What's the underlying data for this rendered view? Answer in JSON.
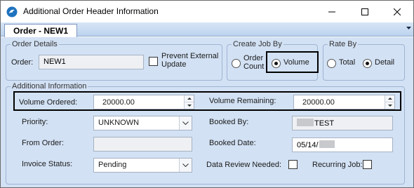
{
  "window": {
    "title": "Additional Order Header Information"
  },
  "tabs": [
    {
      "label": "Order - NEW1"
    }
  ],
  "order_details": {
    "legend": "Order Details",
    "order_label": "Order:",
    "order_value": "NEW1",
    "prevent_update_label": "Prevent External Update",
    "prevent_update_checked": false
  },
  "create_job_by": {
    "legend": "Create Job By",
    "options": [
      {
        "label": "Order Count",
        "selected": false
      },
      {
        "label": "Volume",
        "selected": true
      }
    ]
  },
  "rate_by": {
    "legend": "Rate By",
    "options": [
      {
        "label": "Total",
        "selected": false
      },
      {
        "label": "Detail",
        "selected": true
      }
    ]
  },
  "additional": {
    "legend": "Additional Information",
    "volume_ordered_label": "Volume Ordered:",
    "volume_ordered_value": "20000.00",
    "volume_remaining_label": "Volume Remaining:",
    "volume_remaining_value": "20000.00",
    "priority_label": "Priority:",
    "priority_value": "UNKNOWN",
    "booked_by_label": "Booked By:",
    "booked_by_value": "TEST",
    "from_order_label": "From Order:",
    "from_order_value": "",
    "booked_date_label": "Booked Date:",
    "booked_date_value": "05/14/",
    "invoice_status_label": "Invoice Status:",
    "invoice_status_value": "Pending",
    "data_review_label": "Data Review Needed:",
    "data_review_checked": false,
    "recurring_job_label": "Recurring Job:",
    "recurring_job_checked": false
  },
  "colors": {
    "panel": "#d2e1f4",
    "tab_strip": "#bcd3ee",
    "accent": "#1e73be"
  },
  "icons": [
    "app-icon",
    "minimize-icon",
    "maximize-icon",
    "close-icon",
    "dropdown-arrow-icon",
    "spin-up-icon",
    "spin-down-icon"
  ]
}
